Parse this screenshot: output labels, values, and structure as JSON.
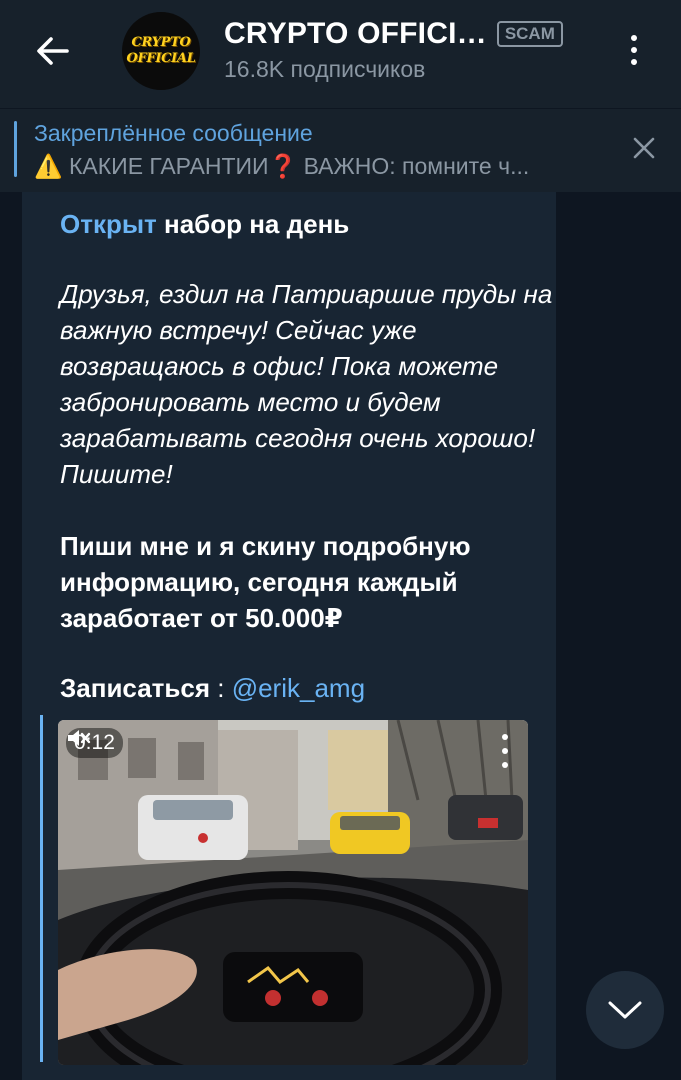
{
  "header": {
    "title": "CRYPTO OFFICI…",
    "scam_badge": "SCAM",
    "subscribers": "16.8K подписчиков",
    "avatar_line1": "CRYPTO",
    "avatar_line2": "OFFICIAL"
  },
  "pinned": {
    "label": "Закреплённое сообщение",
    "warn_icon": "⚠️",
    "caps_text": "КАКИЕ ГАРАНТИИ",
    "question_icon": "❓",
    "rest_text": "ВАЖНО: помните ч..."
  },
  "message": {
    "line1_link": "Открыт",
    "line1_rest": " набор на день",
    "paragraph_italic": "Друзья, ездил на Патриаршие пруды на важную встречу! Сейчас уже возвращаюсь в офис! Пока можете забронировать место и будем зарабатывать сегодня очень хорошо! Пишите!",
    "paragraph_bold": "Пиши мне и я скину подробную информацию, сегодня каждый заработает от 50.000₽",
    "signup_label": "Записаться",
    "signup_sep": " : ",
    "signup_handle": "@erik_amg"
  },
  "video": {
    "duration": "0:12",
    "muted_icon": "speaker-muted-icon"
  },
  "colors": {
    "background": "#0e1621",
    "header": "#17212b",
    "bubble": "#182533",
    "link": "#6ab3f3",
    "muted_text": "#8b97a3"
  }
}
